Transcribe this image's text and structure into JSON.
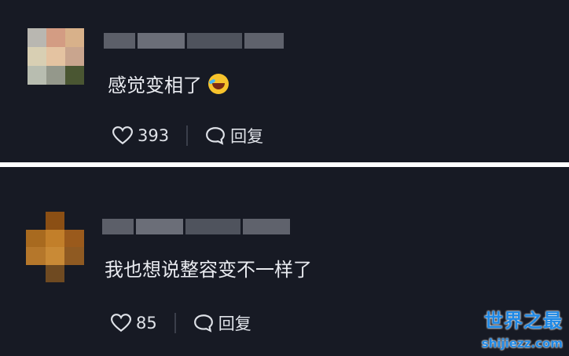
{
  "comments": [
    {
      "text": "感觉变相了",
      "emoji": "laughing-crying-emoji",
      "likes": "393",
      "reply_label": "回复",
      "avatar_colors": [
        "#b9b7b1",
        "#d39c83",
        "#d8b18a",
        "#d8cfb3",
        "#e4c3a1",
        "#c9a58e",
        "#b8bdb0",
        "#94988b",
        "#4a5632"
      ],
      "username_colors": [
        "#5c5f69",
        "#6b6e78",
        "#4f535d",
        "#5f626c"
      ]
    },
    {
      "text": "我也想说整容变不一样了",
      "likes": "85",
      "reply_label": "回复",
      "avatar_colors": [
        "#171a24",
        "#8b4f14",
        "#171a24",
        "#a86a1f",
        "#c27f2a",
        "#9a5a1c",
        "#b5772b",
        "#c98a36",
        "#8f5a22",
        "#171a24",
        "#6f4a21",
        "#171a24"
      ],
      "username_colors": [
        "#5c5f69",
        "#6b6e78",
        "#4f535d",
        "#5f626c"
      ]
    }
  ],
  "colors": {
    "background": "#171a24",
    "text": "#e9ebf0",
    "separator": "#ffffff",
    "watermark": "#1e88e5"
  },
  "watermark": {
    "logo_text": "世界之最",
    "url": "shijiezz.com"
  }
}
